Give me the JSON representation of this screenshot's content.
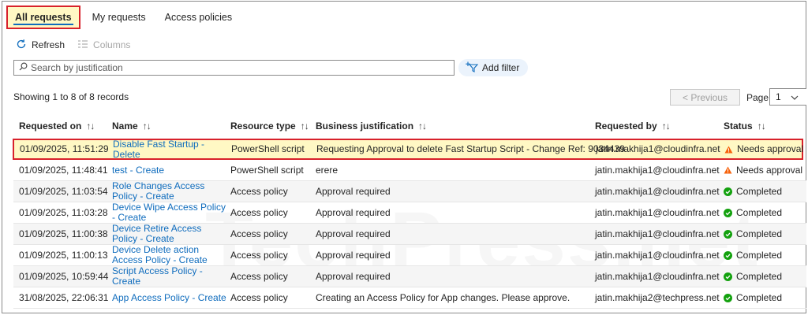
{
  "tabs": [
    {
      "label": "All requests",
      "active": true
    },
    {
      "label": "My requests",
      "active": false
    },
    {
      "label": "Access policies",
      "active": false
    }
  ],
  "toolbar": {
    "refresh_label": "Refresh",
    "columns_label": "Columns"
  },
  "search": {
    "placeholder": "Search by justification",
    "value": ""
  },
  "filter": {
    "add_label": "Add filter"
  },
  "records_text": "Showing 1 to 8 of 8 records",
  "pager": {
    "previous_label": "< Previous",
    "page_label": "Page",
    "page_value": "1"
  },
  "columns": [
    "Requested on",
    "Name",
    "Resource type",
    "Business justification",
    "Requested by",
    "Status"
  ],
  "sort_glyph": "↑↓",
  "rows": [
    {
      "requested_on": "01/09/2025, 11:51:29",
      "name": "Disable Fast Startup - Delete",
      "type": "PowerShell script",
      "justification": "Requesting Approval to delete Fast Startup Script - Change Ref: 9034439",
      "by": "jatin.makhija1@cloudinfra.net",
      "status": "Needs approval",
      "status_kind": "warning"
    },
    {
      "requested_on": "01/09/2025, 11:48:41",
      "name": "test - Create",
      "type": "PowerShell script",
      "justification": "erere",
      "by": "jatin.makhija1@cloudinfra.net",
      "status": "Needs approval",
      "status_kind": "warning"
    },
    {
      "requested_on": "01/09/2025, 11:03:54",
      "name": "Role Changes Access Policy - Create",
      "type": "Access policy",
      "justification": "Approval required",
      "by": "jatin.makhija1@cloudinfra.net",
      "status": "Completed",
      "status_kind": "success"
    },
    {
      "requested_on": "01/09/2025, 11:03:28",
      "name": "Device Wipe Access Policy - Create",
      "type": "Access policy",
      "justification": "Approval required",
      "by": "jatin.makhija1@cloudinfra.net",
      "status": "Completed",
      "status_kind": "success"
    },
    {
      "requested_on": "01/09/2025, 11:00:38",
      "name": "Device Retire Access Policy - Create",
      "type": "Access policy",
      "justification": "Approval required",
      "by": "jatin.makhija1@cloudinfra.net",
      "status": "Completed",
      "status_kind": "success"
    },
    {
      "requested_on": "01/09/2025, 11:00:13",
      "name": "Device Delete action Access Policy - Create",
      "type": "Access policy",
      "justification": "Approval required",
      "by": "jatin.makhija1@cloudinfra.net",
      "status": "Completed",
      "status_kind": "success"
    },
    {
      "requested_on": "01/09/2025, 10:59:44",
      "name": "Script Access Policy - Create",
      "type": "Access policy",
      "justification": "Approval required",
      "by": "jatin.makhija1@cloudinfra.net",
      "status": "Completed",
      "status_kind": "success"
    },
    {
      "requested_on": "31/08/2025, 22:06:31",
      "name": "App Access Policy - Create",
      "type": "Access policy",
      "justification": "Creating an Access Policy for App changes. Please approve.",
      "by": "jatin.makhija2@techpress.net",
      "status": "Completed",
      "status_kind": "success"
    }
  ],
  "watermark": "TechPress.net",
  "colors": {
    "link": "#0f6cbd",
    "warning": "#f7630c",
    "success": "#13a10e",
    "highlight": "#d8212b"
  }
}
